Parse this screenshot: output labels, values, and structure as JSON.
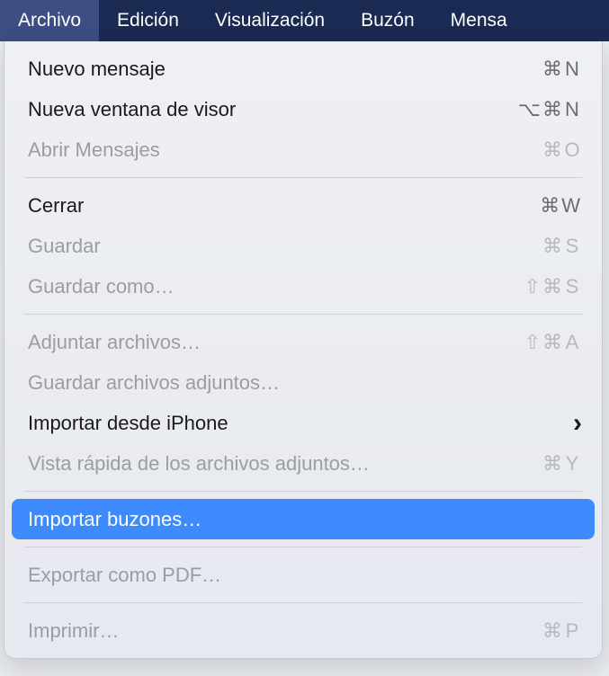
{
  "menubar": {
    "items": [
      {
        "label": "Archivo",
        "active": true
      },
      {
        "label": "Edición",
        "active": false
      },
      {
        "label": "Visualización",
        "active": false
      },
      {
        "label": "Buzón",
        "active": false
      },
      {
        "label": "Mensa",
        "active": false
      }
    ]
  },
  "dropdown": {
    "groups": [
      [
        {
          "label": "Nuevo mensaje",
          "shortcut": "⌘ N",
          "disabled": false,
          "highlighted": false,
          "submenu": false
        },
        {
          "label": "Nueva ventana de visor",
          "shortcut": "⌥ ⌘ N",
          "disabled": false,
          "highlighted": false,
          "submenu": false
        },
        {
          "label": "Abrir Mensajes",
          "shortcut": "⌘ O",
          "disabled": true,
          "highlighted": false,
          "submenu": false
        }
      ],
      [
        {
          "label": "Cerrar",
          "shortcut": "⌘ W",
          "disabled": false,
          "highlighted": false,
          "submenu": false
        },
        {
          "label": "Guardar",
          "shortcut": "⌘ S",
          "disabled": true,
          "highlighted": false,
          "submenu": false
        },
        {
          "label": "Guardar como…",
          "shortcut": "⇧ ⌘ S",
          "disabled": true,
          "highlighted": false,
          "submenu": false
        }
      ],
      [
        {
          "label": "Adjuntar archivos…",
          "shortcut": "⇧ ⌘ A",
          "disabled": true,
          "highlighted": false,
          "submenu": false
        },
        {
          "label": "Guardar archivos adjuntos…",
          "shortcut": "",
          "disabled": true,
          "highlighted": false,
          "submenu": false
        },
        {
          "label": "Importar desde iPhone",
          "shortcut": "",
          "disabled": false,
          "highlighted": false,
          "submenu": true
        },
        {
          "label": "Vista rápida de los archivos adjuntos…",
          "shortcut": "⌘ Y",
          "disabled": true,
          "highlighted": false,
          "submenu": false
        }
      ],
      [
        {
          "label": "Importar buzones…",
          "shortcut": "",
          "disabled": false,
          "highlighted": true,
          "submenu": false
        }
      ],
      [
        {
          "label": "Exportar como PDF…",
          "shortcut": "",
          "disabled": true,
          "highlighted": false,
          "submenu": false
        }
      ],
      [
        {
          "label": "Imprimir…",
          "shortcut": "⌘ P",
          "disabled": true,
          "highlighted": false,
          "submenu": false
        }
      ]
    ]
  }
}
